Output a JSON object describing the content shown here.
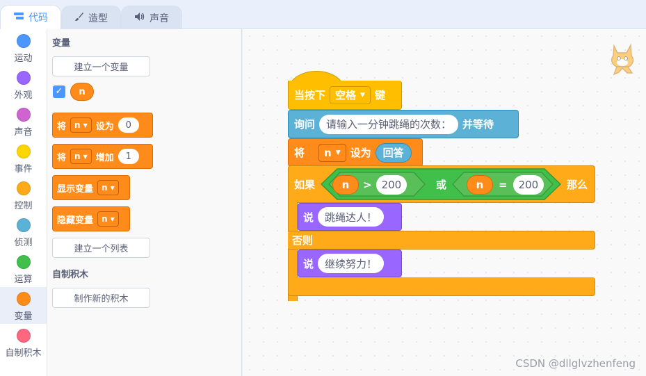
{
  "tabs": [
    {
      "label": "代码",
      "icon": "code-icon"
    },
    {
      "label": "造型",
      "icon": "brush-icon"
    },
    {
      "label": "声音",
      "icon": "speaker-icon"
    }
  ],
  "categories": [
    {
      "label": "运动",
      "color": "#4c97ff"
    },
    {
      "label": "外观",
      "color": "#9966ff"
    },
    {
      "label": "声音",
      "color": "#cf63cf"
    },
    {
      "label": "事件",
      "color": "#ffd500"
    },
    {
      "label": "控制",
      "color": "#ffab19"
    },
    {
      "label": "侦测",
      "color": "#5cb1d6"
    },
    {
      "label": "运算",
      "color": "#40bf4a"
    },
    {
      "label": "变量",
      "color": "#ff8c1a"
    },
    {
      "label": "自制积木",
      "color": "#ff6680"
    }
  ],
  "palette": {
    "variables_title": "变量",
    "make_variable": "建立一个变量",
    "var_name": "n",
    "set_block": {
      "prefix": "将",
      "var": "n",
      "op": "设为",
      "value": "0"
    },
    "change_block": {
      "prefix": "将",
      "var": "n",
      "op": "增加",
      "value": "1"
    },
    "show_block": {
      "label": "显示变量",
      "var": "n"
    },
    "hide_block": {
      "label": "隐藏变量",
      "var": "n"
    },
    "make_list": "建立一个列表",
    "myblocks_title": "自制积木",
    "make_block": "制作新的积木"
  },
  "script": {
    "when_key": {
      "label": "当按下",
      "key": "空格",
      "suffix": "键"
    },
    "ask": {
      "label": "询问",
      "question": "请输入一分钟跳绳的次数：",
      "suffix": "并等待"
    },
    "set": {
      "prefix": "将",
      "var": "n",
      "op": "设为",
      "answer": "回答"
    },
    "if": {
      "label": "如果",
      "left_var": "n",
      "gt": ">",
      "left_val": "200",
      "or": "或",
      "right_var": "n",
      "eq": "=",
      "right_val": "200",
      "then": "那么"
    },
    "say1": {
      "label": "说",
      "text": "跳绳达人！"
    },
    "else": "否则",
    "say2": {
      "label": "说",
      "text": "继续努力！"
    }
  },
  "watermark": "CSDN @dllglvzhenfeng"
}
